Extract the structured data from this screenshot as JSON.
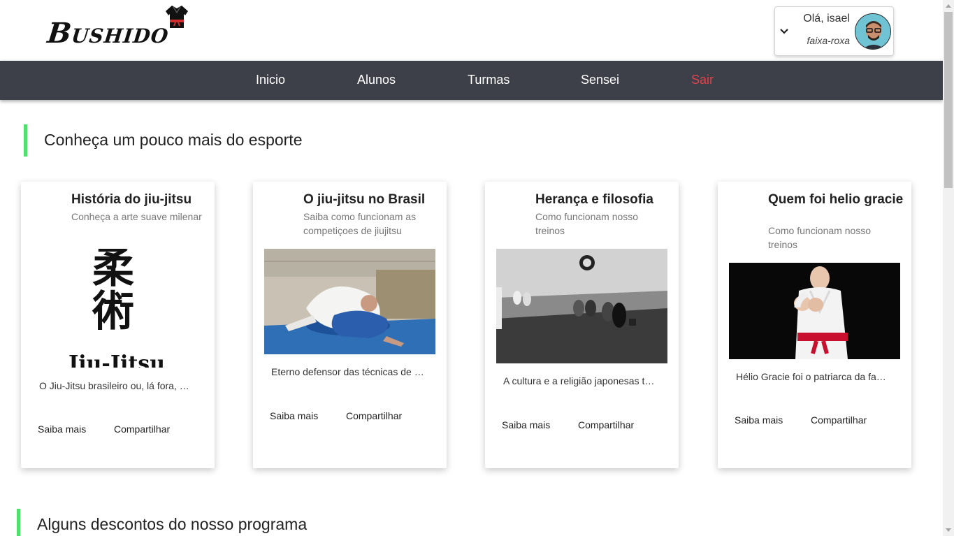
{
  "brand": {
    "logo_text": "Bushido",
    "logo_icon": "kimono-icon"
  },
  "user": {
    "greeting": "Olá, isael",
    "belt": "faixa-roxa",
    "chevron_icon": "chevron-down-icon"
  },
  "nav": {
    "items": [
      "Inicio",
      "Alunos",
      "Turmas",
      "Sensei",
      "Sair"
    ]
  },
  "sections": {
    "sport_title": "Conheça um pouco mais do esporte",
    "discounts_title": "Alguns descontos do nosso programa"
  },
  "cards": [
    {
      "title": "História do jiu-jitsu",
      "subtitle": "Conheça a arte suave milenar",
      "image_caption": "Jiu-Jitsu",
      "image_kanji": [
        "柔",
        "術"
      ],
      "text": "O Jiu-Jitsu brasileiro ou, lá fora, o BJJ é uma arte marcial",
      "more": "Saiba mais",
      "share": "Compartilhar"
    },
    {
      "title": "O jiu-jitsu no Brasil",
      "subtitle": "Saiba como funcionam as competiçoes de jiujitsu",
      "text": "Eterno defensor das técnicas de defesa pessoal",
      "more": "Saiba mais",
      "share": "Compartilhar"
    },
    {
      "title": "Herança e filosofia",
      "subtitle": "Como funcionam nosso treinos",
      "text": "A cultura e a religião japonesas tornaram o jiu-jitsu",
      "more": "Saiba mais",
      "share": "Compartilhar"
    },
    {
      "title": "Quem foi helio gracie",
      "subtitle": "Como funcionam nosso treinos",
      "text": "Hélio Gracie foi o patriarca da família Gracie",
      "more": "Saiba mais",
      "share": "Compartilhar"
    }
  ],
  "colors": {
    "nav_bg": "#3e4049",
    "exit": "#e0434b",
    "accent_bar": "#4ee06a"
  }
}
